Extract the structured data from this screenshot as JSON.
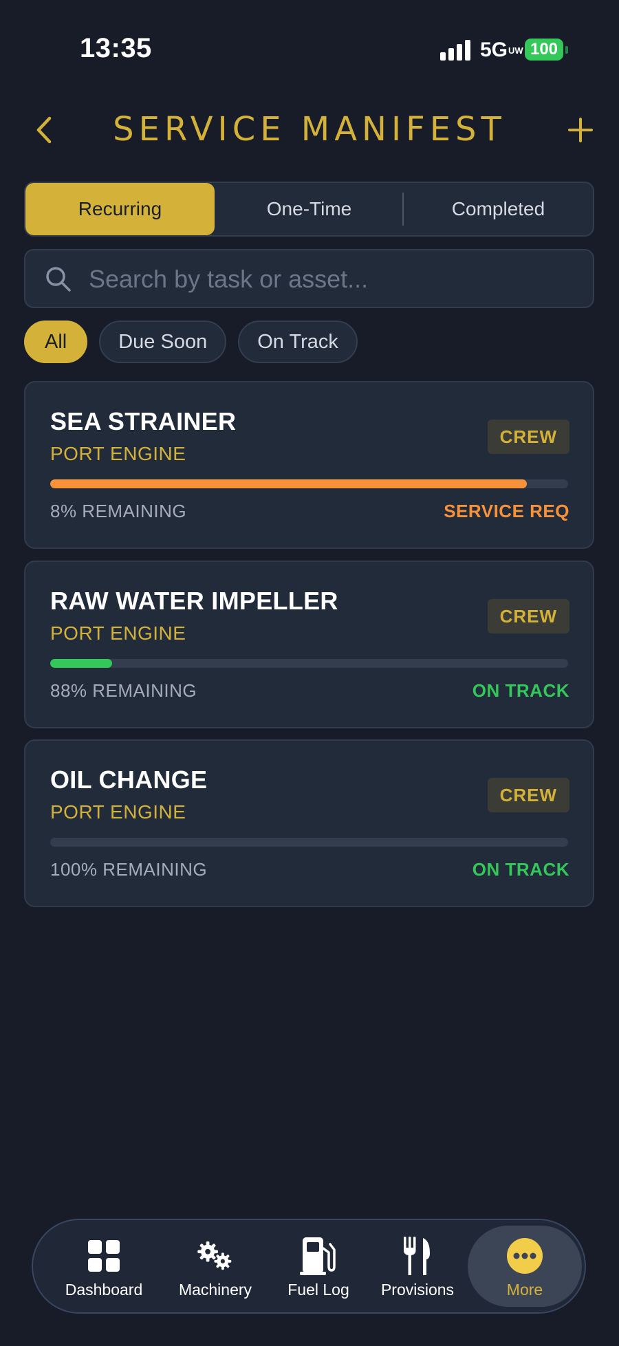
{
  "status_bar": {
    "time": "13:35",
    "network": "5G",
    "network_suffix": "UW",
    "battery": "100"
  },
  "header": {
    "title": "SERVICE MANIFEST",
    "back_icon": "chevron-left-icon",
    "add_icon": "plus-icon"
  },
  "tabs": [
    {
      "label": "Recurring",
      "active": true
    },
    {
      "label": "One-Time",
      "active": false
    },
    {
      "label": "Completed",
      "active": false
    }
  ],
  "search": {
    "placeholder": "Search by task or asset...",
    "value": ""
  },
  "filters": [
    {
      "label": "All",
      "active": true
    },
    {
      "label": "Due Soon",
      "active": false
    },
    {
      "label": "On Track",
      "active": false
    }
  ],
  "tasks": [
    {
      "title": "SEA STRAINER",
      "asset": "PORT ENGINE",
      "badge": "CREW",
      "remaining_percent": 8,
      "remaining_label": "8% REMAINING",
      "status": "SERVICE REQ",
      "status_color": "#f7923a"
    },
    {
      "title": "RAW WATER IMPELLER",
      "asset": "PORT ENGINE",
      "badge": "CREW",
      "remaining_percent": 88,
      "remaining_label": "88% REMAINING",
      "status": "ON TRACK",
      "status_color": "#34c759"
    },
    {
      "title": "OIL CHANGE",
      "asset": "PORT ENGINE",
      "badge": "CREW",
      "remaining_percent": 100,
      "remaining_label": "100% REMAINING",
      "status": "ON TRACK",
      "status_color": "#34c759"
    }
  ],
  "bottom_nav": [
    {
      "label": "Dashboard",
      "icon": "dashboard-grid-icon",
      "active": false
    },
    {
      "label": "Machinery",
      "icon": "gears-icon",
      "active": false
    },
    {
      "label": "Fuel Log",
      "icon": "fuel-pump-icon",
      "active": false
    },
    {
      "label": "Provisions",
      "icon": "fork-knife-icon",
      "active": false
    },
    {
      "label": "More",
      "icon": "more-dots-icon",
      "active": true
    }
  ],
  "colors": {
    "accent": "#d4b23a",
    "background": "#171c28",
    "card": "#222b3a",
    "warning": "#f7923a",
    "ok": "#34c759"
  }
}
